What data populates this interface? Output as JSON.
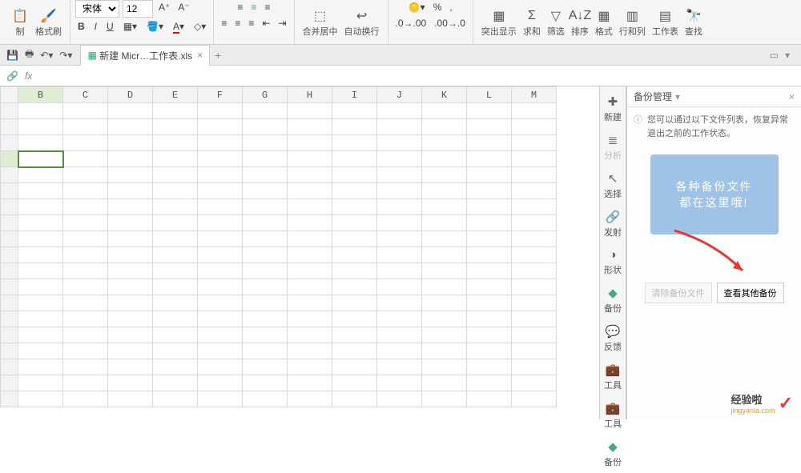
{
  "ribbon": {
    "paste_label": "制",
    "format_painter": "格式刷",
    "font_name": "宋体",
    "font_size": "12",
    "merge_center": "合并居中",
    "wrap_text": "自动换行",
    "highlight": "突出显示",
    "sum": "求和",
    "filter": "筛选",
    "sort": "排序",
    "format": "格式",
    "rows_cols": "行和列",
    "worksheet": "工作表",
    "find": "查找"
  },
  "tabs": {
    "file_name": "新建 Micr…工作表.xls"
  },
  "formula": {
    "fx": "fx"
  },
  "columns": [
    "B",
    "C",
    "D",
    "E",
    "F",
    "G",
    "H",
    "I",
    "J",
    "K",
    "L",
    "M"
  ],
  "rail": {
    "new": "新建",
    "analyze": "分析",
    "select": "选择",
    "emit": "发射",
    "shape": "形状",
    "backup": "备份",
    "feedback": "反馈",
    "tools": "工具",
    "tools2": "工具",
    "backup2": "备份"
  },
  "panel": {
    "title": "备份管理",
    "info": "您可以通过以下文件列表，恢复异常退出之前的工作状态。",
    "promo_line1": "各种备份文件",
    "promo_line2": "都在这里哦!",
    "clear_btn": "清除备份文件",
    "view_btn": "查看其他备份"
  },
  "watermark": {
    "main": "经验啦",
    "sub": "jingyanla.com"
  }
}
